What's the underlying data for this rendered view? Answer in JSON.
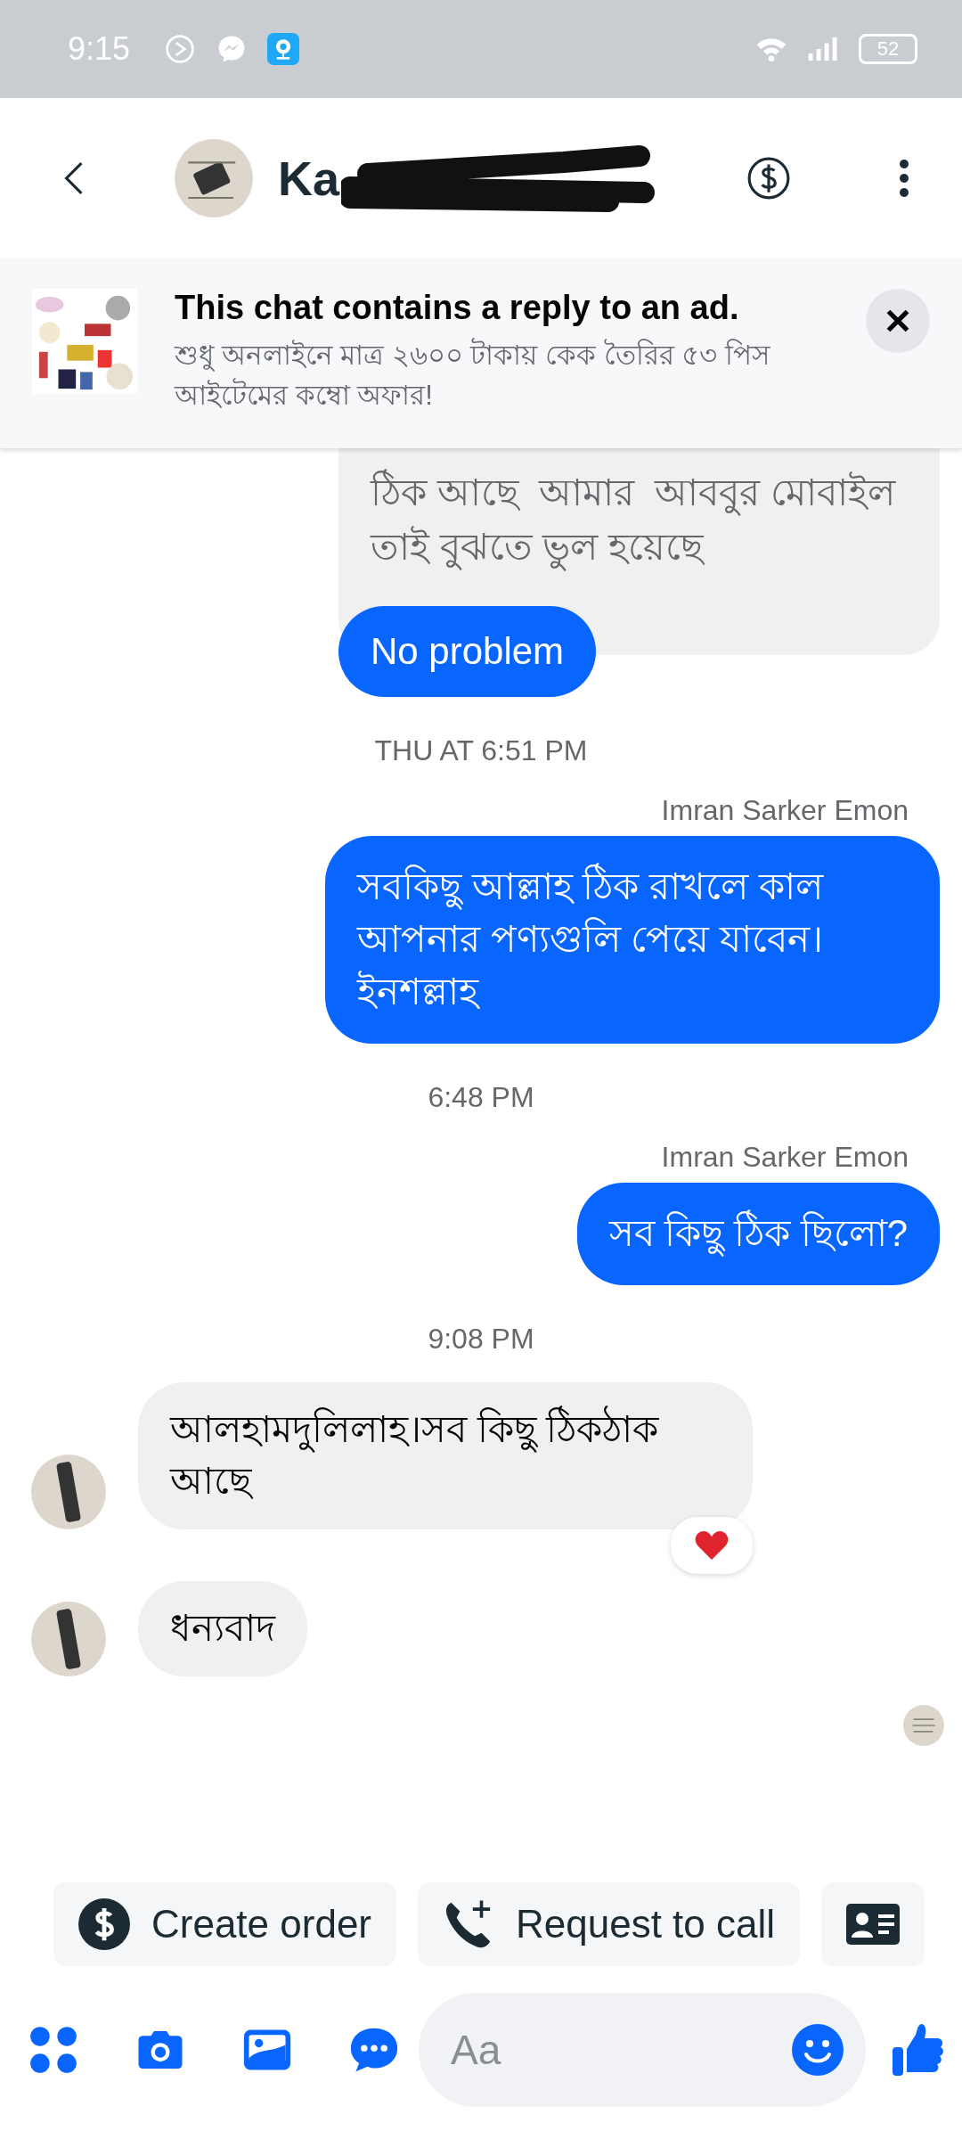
{
  "status_bar": {
    "time": "9:15",
    "battery": "52"
  },
  "header": {
    "name": "Ka"
  },
  "ad_banner": {
    "title": "This chat contains a reply to an ad.",
    "text": "শুধু অনলাইনে মাত্র ২৬০০ টাকায় কেক তৈরির ৫৩ পিস আইটেমের কম্বো অফার!"
  },
  "messages": [
    {
      "kind": "reply",
      "quoted": "ঠিক আছে  আমার  আববুর মোবাইল  তাই বুঝতে ভুল হয়েছে",
      "text": "No problem"
    },
    {
      "kind": "timestamp",
      "text": "THU AT 6:51 PM"
    },
    {
      "kind": "sender",
      "text": "Imran Sarker Emon"
    },
    {
      "kind": "outgoing",
      "text": "সবকিছু আল্লাহ ঠিক রাখলে কাল আপনার পণ্যগুলি পেয়ে যাবেন। ইনশল্লাহ"
    },
    {
      "kind": "timestamp",
      "text": "6:48 PM"
    },
    {
      "kind": "sender",
      "text": "Imran Sarker Emon"
    },
    {
      "kind": "outgoing",
      "text": "সব কিছু ঠিক ছিলো?"
    },
    {
      "kind": "timestamp",
      "text": "9:08 PM"
    },
    {
      "kind": "incoming",
      "text": "আলহামদুলিলাহ।সব কিছু ঠিকঠাক আছে",
      "reaction": true
    },
    {
      "kind": "incoming",
      "text": "ধন্যবাদ",
      "reaction": false
    },
    {
      "kind": "seen"
    }
  ],
  "quick_replies": [
    {
      "kind": "order",
      "label": "Create order"
    },
    {
      "kind": "call",
      "label": "Request to call"
    },
    {
      "kind": "contact"
    }
  ],
  "composer": {
    "placeholder": "Aa"
  }
}
